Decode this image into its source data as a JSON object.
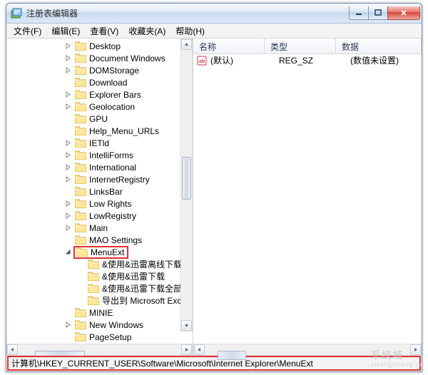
{
  "title": "注册表编辑器",
  "menu": {
    "file": "文件(F)",
    "edit": "编辑(E)",
    "view": "查看(V)",
    "fav": "收藏夹(A)",
    "help": "帮助(H)"
  },
  "tree": [
    {
      "label": "Desktop",
      "depth": 4,
      "arrow": "collapsed"
    },
    {
      "label": "Document Windows",
      "depth": 4,
      "arrow": "collapsed"
    },
    {
      "label": "DOMStorage",
      "depth": 4,
      "arrow": "collapsed"
    },
    {
      "label": "Download",
      "depth": 4,
      "arrow": "none"
    },
    {
      "label": "Explorer Bars",
      "depth": 4,
      "arrow": "collapsed"
    },
    {
      "label": "Geolocation",
      "depth": 4,
      "arrow": "collapsed"
    },
    {
      "label": "GPU",
      "depth": 4,
      "arrow": "none"
    },
    {
      "label": "Help_Menu_URLs",
      "depth": 4,
      "arrow": "none"
    },
    {
      "label": "IETld",
      "depth": 4,
      "arrow": "collapsed"
    },
    {
      "label": "IntelliForms",
      "depth": 4,
      "arrow": "collapsed"
    },
    {
      "label": "International",
      "depth": 4,
      "arrow": "collapsed"
    },
    {
      "label": "InternetRegistry",
      "depth": 4,
      "arrow": "collapsed"
    },
    {
      "label": "LinksBar",
      "depth": 4,
      "arrow": "none"
    },
    {
      "label": "Low Rights",
      "depth": 4,
      "arrow": "collapsed"
    },
    {
      "label": "LowRegistry",
      "depth": 4,
      "arrow": "collapsed"
    },
    {
      "label": "Main",
      "depth": 4,
      "arrow": "collapsed"
    },
    {
      "label": "MAO Settings",
      "depth": 4,
      "arrow": "none"
    },
    {
      "label": "MenuExt",
      "depth": 4,
      "arrow": "expanded",
      "highlight": true
    },
    {
      "label": "&使用&迅雷离线下载",
      "depth": 5,
      "arrow": "none"
    },
    {
      "label": "&使用&迅雷下载",
      "depth": 5,
      "arrow": "none"
    },
    {
      "label": "&使用&迅雷下载全部",
      "depth": 5,
      "arrow": "none"
    },
    {
      "label": "导出到 Microsoft Exc",
      "depth": 5,
      "arrow": "none"
    },
    {
      "label": "MINIE",
      "depth": 4,
      "arrow": "none"
    },
    {
      "label": "New Windows",
      "depth": 4,
      "arrow": "collapsed"
    },
    {
      "label": "PageSetup",
      "depth": 4,
      "arrow": "none"
    }
  ],
  "columns": {
    "name": "名称",
    "type": "类型",
    "data": "数据"
  },
  "rows": [
    {
      "name": "(默认)",
      "type": "REG_SZ",
      "data": "(数值未设置)"
    }
  ],
  "statusbar": "计算机\\HKEY_CURRENT_USER\\Software\\Microsoft\\Internet Explorer\\MenuExt",
  "watermark": {
    "big": "系统城",
    "small": "xitongcheng.cc"
  }
}
